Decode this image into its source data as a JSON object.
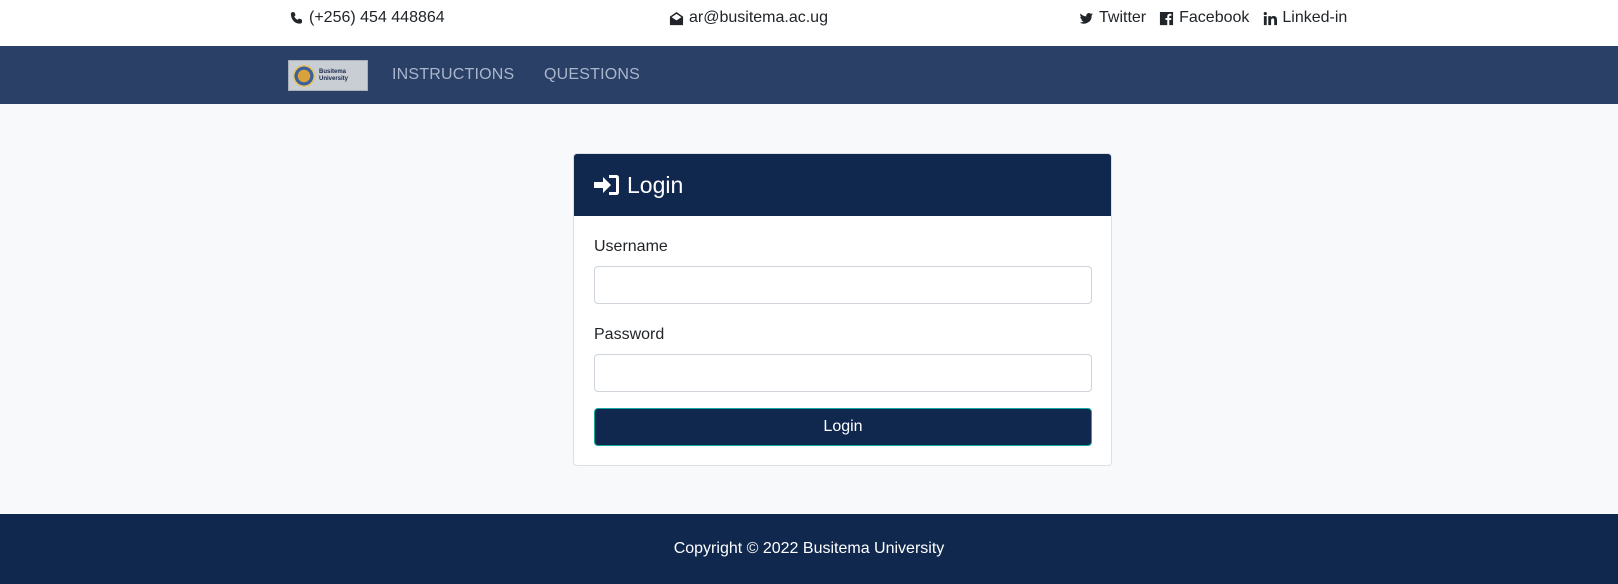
{
  "topbar": {
    "phone": "(+256) 454 448864",
    "email": "ar@busitema.ac.ug",
    "social": [
      {
        "label": "Twitter",
        "icon": "twitter-icon"
      },
      {
        "label": "Facebook",
        "icon": "facebook-icon"
      },
      {
        "label": "Linked-in",
        "icon": "linkedin-icon"
      }
    ]
  },
  "navbar": {
    "logo_text": [
      "Busitema",
      "University"
    ],
    "links": [
      "INSTRUCTIONS",
      "QUESTIONS"
    ]
  },
  "login": {
    "title": "Login",
    "username_label": "Username",
    "username_value": "",
    "password_label": "Password",
    "password_value": "",
    "button_label": "Login"
  },
  "footer": {
    "copyright": "Copyright © 2022 Busitema University"
  },
  "colors": {
    "navbar_bg": "#2b4066",
    "primary_dark": "#10274e",
    "page_bg": "#f8f9fa",
    "nav_link": "#a9b6cc"
  }
}
